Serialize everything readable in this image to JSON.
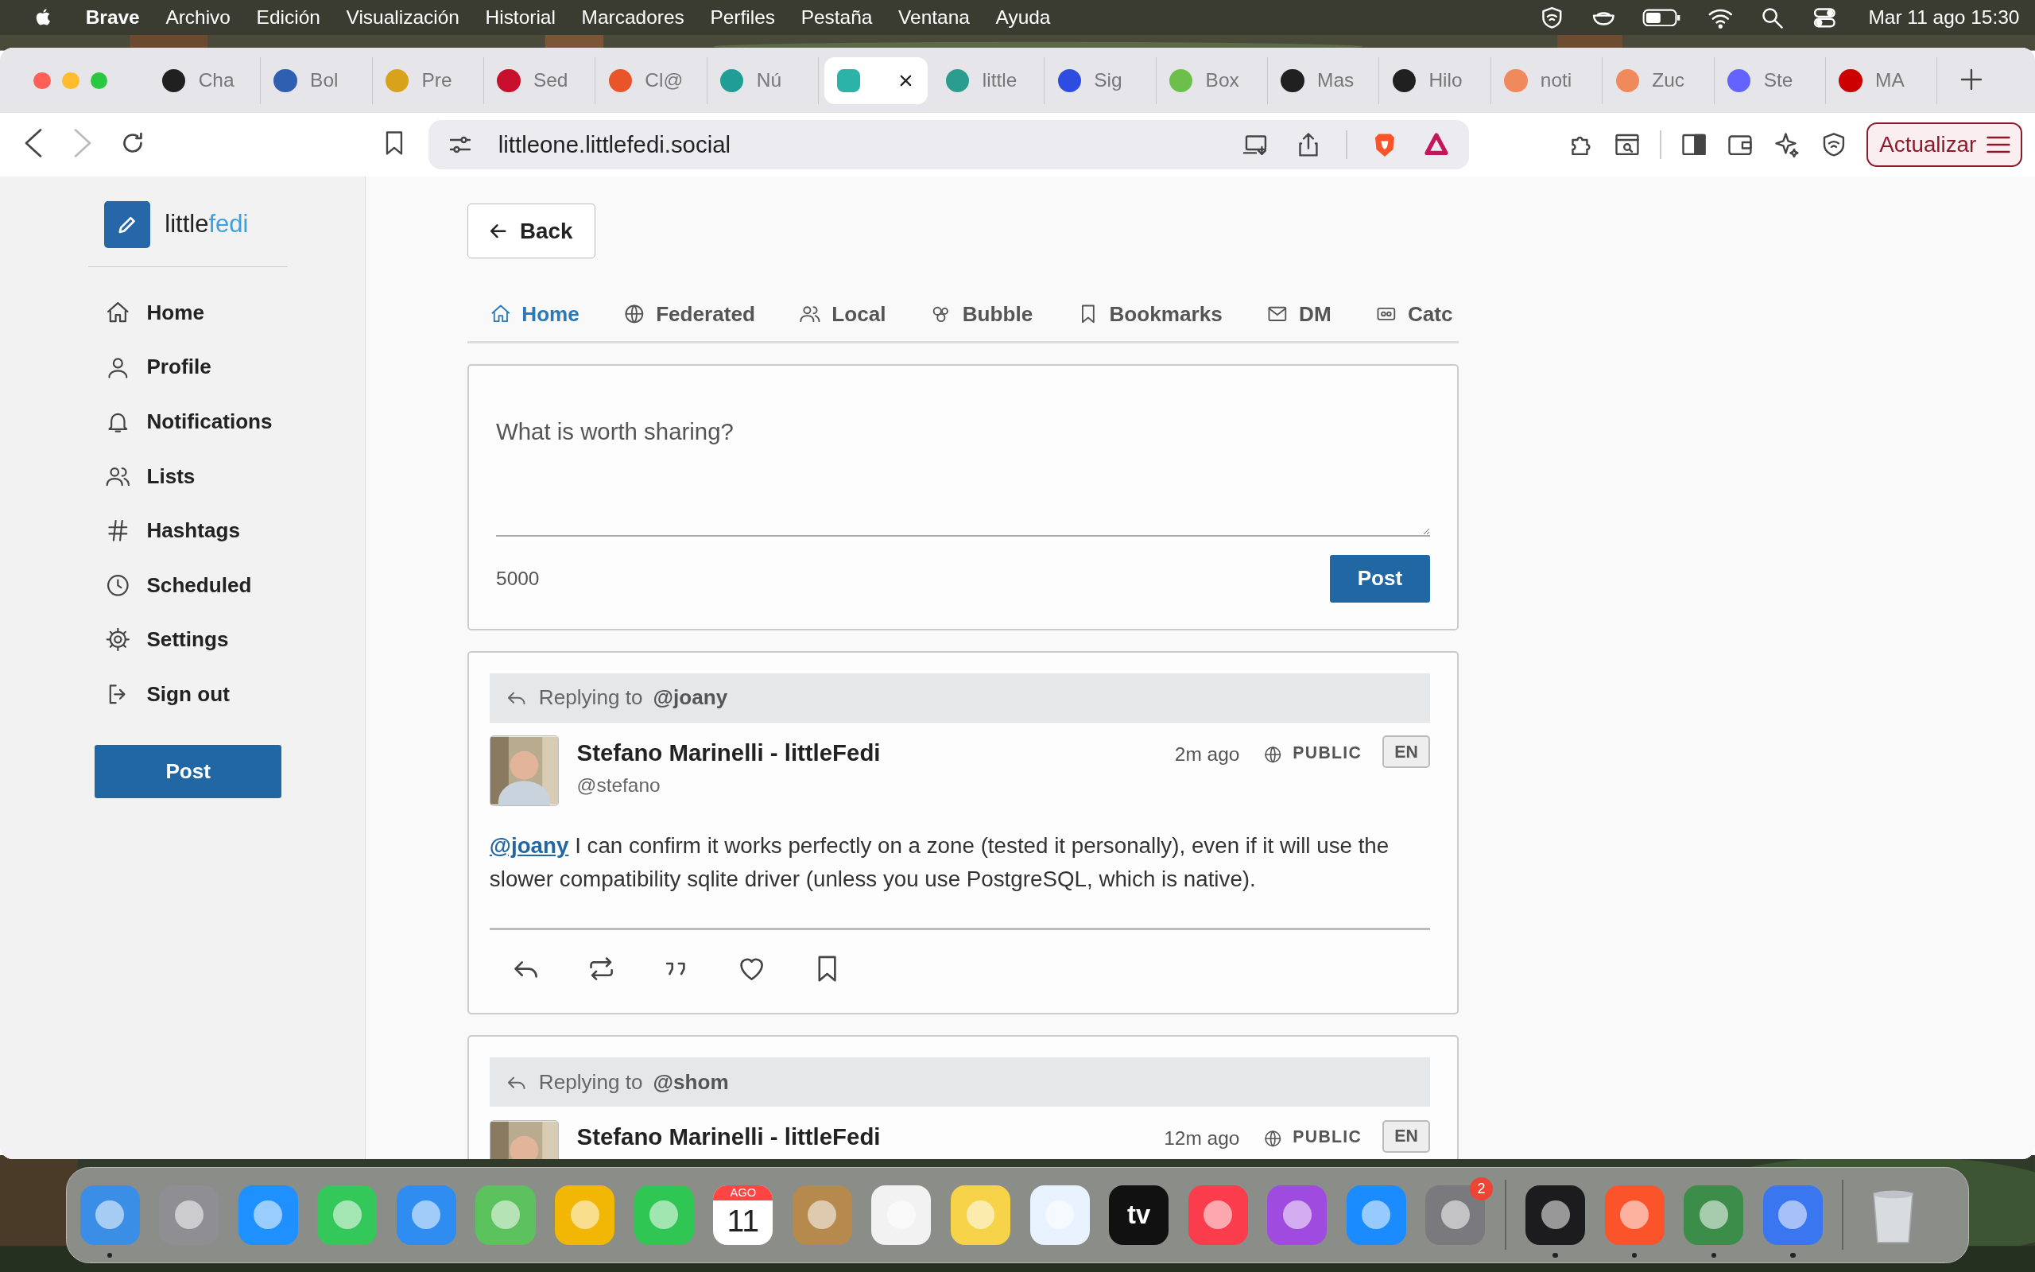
{
  "menu_bar": {
    "app": "Brave",
    "items": [
      "Archivo",
      "Edición",
      "Visualización",
      "Historial",
      "Marcadores",
      "Perfiles",
      "Pestaña",
      "Ventana",
      "Ayuda"
    ],
    "clock": "Mar 11 ago 15:30"
  },
  "tabs": [
    {
      "title": "Cha",
      "color": "#202020",
      "selected": false
    },
    {
      "title": "Bol",
      "color": "#2f5fb0",
      "selected": false
    },
    {
      "title": "Pre",
      "color": "#d9a21b",
      "selected": false
    },
    {
      "title": "Sed",
      "color": "#c8102e",
      "selected": false
    },
    {
      "title": "Cl@",
      "color": "#e8552a",
      "selected": false
    },
    {
      "title": "Nú",
      "color": "#1e9e94",
      "selected": false
    },
    {
      "color": "#2ab3a6",
      "selected": true
    },
    {
      "title": "little",
      "color": "#2a9d8f",
      "selected": false
    },
    {
      "title": "Sig",
      "color": "#2f4ce0",
      "selected": false
    },
    {
      "title": "Box",
      "color": "#6cbf4a",
      "selected": false
    },
    {
      "title": "Mas",
      "color": "#202020",
      "selected": false
    },
    {
      "title": "Hilo",
      "color": "#202020",
      "selected": false
    },
    {
      "title": "noti",
      "color": "#f08a5d",
      "selected": false
    },
    {
      "title": "Zuc",
      "color": "#f08a5d",
      "selected": false
    },
    {
      "title": "Ste",
      "color": "#6364ff",
      "selected": false
    },
    {
      "title": "MA",
      "color": "#cc0000",
      "selected": false
    }
  ],
  "toolbar": {
    "url": "littleone.littlefedi.social",
    "forward_disabled": true,
    "update_button": "Actualizar"
  },
  "sidebar": {
    "logo": {
      "text": "little",
      "accent": "fedi"
    },
    "items": [
      {
        "kind": "home",
        "label": "Home"
      },
      {
        "kind": "profile",
        "label": "Profile"
      },
      {
        "kind": "notifications",
        "label": "Notifications"
      },
      {
        "kind": "lists",
        "label": "Lists"
      },
      {
        "kind": "hashtags",
        "label": "Hashtags"
      },
      {
        "kind": "scheduled",
        "label": "Scheduled"
      },
      {
        "kind": "settings",
        "label": "Settings"
      },
      {
        "kind": "signout",
        "label": "Sign out"
      }
    ],
    "post_button": "Post"
  },
  "back_button": "Back",
  "timeline_tabs": [
    {
      "kind": "home",
      "label": "Home",
      "selected": true
    },
    {
      "kind": "federated",
      "label": "Federated",
      "selected": false
    },
    {
      "kind": "local",
      "label": "Local",
      "selected": false
    },
    {
      "kind": "bubble",
      "label": "Bubble",
      "selected": false
    },
    {
      "kind": "bookmarks",
      "label": "Bookmarks",
      "selected": false
    },
    {
      "kind": "dm",
      "label": "DM",
      "selected": false
    },
    {
      "kind": "catch",
      "label": "Catc",
      "selected": false
    }
  ],
  "compose": {
    "placeholder": "What is worth sharing?",
    "counter": "5000",
    "button": "Post"
  },
  "posts": [
    {
      "replying_label": "Replying to",
      "replying_to": "@joany",
      "author": "Stefano Marinelli - littleFedi",
      "handle": "@stefano",
      "time": "2m ago",
      "visibility": "PUBLIC",
      "language": "EN",
      "mention": "@joany",
      "text": "I can confirm it works perfectly on a zone (tested it personally), even if it will use the slower compatibility sqlite driver (unless you use PostgreSQL, which is native)."
    },
    {
      "replying_label": "Replying to",
      "replying_to": "@shom",
      "author": "Stefano Marinelli - littleFedi",
      "time": "12m ago",
      "visibility": "PUBLIC",
      "language": "EN"
    }
  ],
  "dock": [
    {
      "kind": "app",
      "color": "#3a8ee6",
      "running": true
    },
    {
      "kind": "app",
      "color": "#8e8e93",
      "running": false
    },
    {
      "kind": "app",
      "color": "#1e90ff",
      "running": false
    },
    {
      "kind": "app",
      "color": "#34c759",
      "running": false
    },
    {
      "kind": "app",
      "color": "#2f8cf0",
      "running": false
    },
    {
      "kind": "app",
      "color": "#5bc25e",
      "running": false
    },
    {
      "kind": "app",
      "color": "#f2b705",
      "running": false
    },
    {
      "kind": "app",
      "color": "#2fc653",
      "running": false
    },
    {
      "kind": "calendar",
      "month": "AGO",
      "day": "11",
      "running": false
    },
    {
      "kind": "app",
      "color": "#b58a4c",
      "running": false
    },
    {
      "kind": "app",
      "color": "#f2f2f2",
      "running": false
    },
    {
      "kind": "app",
      "color": "#f7d34a",
      "running": false
    },
    {
      "kind": "app",
      "color": "#e9f3ff",
      "running": false
    },
    {
      "kind": "tv",
      "label": "tv",
      "running": false
    },
    {
      "kind": "app",
      "color": "#fa3c4c",
      "running": false
    },
    {
      "kind": "app",
      "color": "#a04be0",
      "running": false
    },
    {
      "kind": "app",
      "color": "#1a8cff",
      "running": false
    },
    {
      "kind": "app",
      "color": "#7a7a7e",
      "badge": "2",
      "running": false
    },
    {
      "kind": "separator"
    },
    {
      "kind": "app",
      "color": "#1c1c1e",
      "running": true
    },
    {
      "kind": "app",
      "color": "#fb542b",
      "running": true
    },
    {
      "kind": "app",
      "color": "#3c8d4a",
      "running": true
    },
    {
      "kind": "app",
      "color": "#3a76f0",
      "running": true
    },
    {
      "kind": "separator"
    },
    {
      "kind": "trash",
      "running": false
    }
  ]
}
